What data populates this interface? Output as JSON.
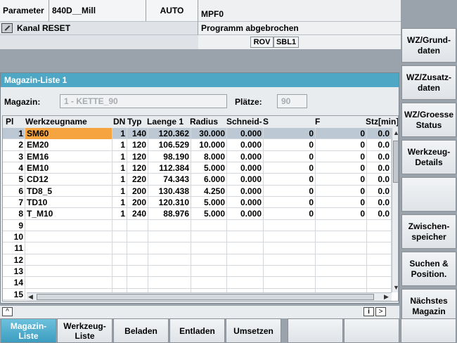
{
  "header": {
    "label": "Parameter",
    "machine": "840D__Mill",
    "mode": "AUTO",
    "program": "MPF0",
    "channel_status": "Kanal RESET",
    "program_status": "Programm abgebrochen",
    "flags": [
      "ROV",
      "SBL1"
    ]
  },
  "window": {
    "title": "Magazin-Liste 1",
    "magazin_label": "Magazin:",
    "magazin_value": "1 - KETTE_90",
    "plaetze_label": "Plätze:",
    "plaetze_value": "90"
  },
  "table": {
    "columns": [
      "Pl",
      "Werkzeugname",
      "DN",
      "Typ",
      "Laenge 1",
      "Radius",
      "Schneid-",
      "S",
      "F",
      "Stz[min]"
    ],
    "rows": [
      {
        "pl": "1",
        "name": "SM60",
        "dn": "1",
        "typ": "140",
        "laenge": "120.362",
        "radius": "30.000",
        "schneid": "0.000",
        "s": "0",
        "f": "0",
        "stz": "0.0"
      },
      {
        "pl": "2",
        "name": "EM20",
        "dn": "1",
        "typ": "120",
        "laenge": "106.529",
        "radius": "10.000",
        "schneid": "0.000",
        "s": "0",
        "f": "0",
        "stz": "0.0"
      },
      {
        "pl": "3",
        "name": "EM16",
        "dn": "1",
        "typ": "120",
        "laenge": "98.190",
        "radius": "8.000",
        "schneid": "0.000",
        "s": "0",
        "f": "0",
        "stz": "0.0"
      },
      {
        "pl": "4",
        "name": "EM10",
        "dn": "1",
        "typ": "120",
        "laenge": "112.384",
        "radius": "5.000",
        "schneid": "0.000",
        "s": "0",
        "f": "0",
        "stz": "0.0"
      },
      {
        "pl": "5",
        "name": "CD12",
        "dn": "1",
        "typ": "220",
        "laenge": "74.343",
        "radius": "6.000",
        "schneid": "0.000",
        "s": "0",
        "f": "0",
        "stz": "0.0"
      },
      {
        "pl": "6",
        "name": "TD8_5",
        "dn": "1",
        "typ": "200",
        "laenge": "130.438",
        "radius": "4.250",
        "schneid": "0.000",
        "s": "0",
        "f": "0",
        "stz": "0.0"
      },
      {
        "pl": "7",
        "name": "TD10",
        "dn": "1",
        "typ": "200",
        "laenge": "120.310",
        "radius": "5.000",
        "schneid": "0.000",
        "s": "0",
        "f": "0",
        "stz": "0.0"
      },
      {
        "pl": "8",
        "name": "T_M10",
        "dn": "1",
        "typ": "240",
        "laenge": "88.976",
        "radius": "5.000",
        "schneid": "0.000",
        "s": "0",
        "f": "0",
        "stz": "0.0"
      },
      {
        "pl": "9",
        "name": "",
        "dn": "",
        "typ": "",
        "laenge": "",
        "radius": "",
        "schneid": "",
        "s": "",
        "f": "",
        "stz": ""
      },
      {
        "pl": "10",
        "name": "",
        "dn": "",
        "typ": "",
        "laenge": "",
        "radius": "",
        "schneid": "",
        "s": "",
        "f": "",
        "stz": ""
      },
      {
        "pl": "11",
        "name": "",
        "dn": "",
        "typ": "",
        "laenge": "",
        "radius": "",
        "schneid": "",
        "s": "",
        "f": "",
        "stz": ""
      },
      {
        "pl": "12",
        "name": "",
        "dn": "",
        "typ": "",
        "laenge": "",
        "radius": "",
        "schneid": "",
        "s": "",
        "f": "",
        "stz": ""
      },
      {
        "pl": "13",
        "name": "",
        "dn": "",
        "typ": "",
        "laenge": "",
        "radius": "",
        "schneid": "",
        "s": "",
        "f": "",
        "stz": ""
      },
      {
        "pl": "14",
        "name": "",
        "dn": "",
        "typ": "",
        "laenge": "",
        "radius": "",
        "schneid": "",
        "s": "",
        "f": "",
        "stz": ""
      },
      {
        "pl": "15",
        "name": "",
        "dn": "",
        "typ": "",
        "laenge": "",
        "radius": "",
        "schneid": "",
        "s": "",
        "f": "",
        "stz": ""
      }
    ]
  },
  "right_softkeys": [
    "WZ/Grund-\ndaten",
    "WZ/Zusatz-\ndaten",
    "WZ/Groesse\nStatus",
    "Werkzeug-\nDetails",
    "",
    "Zwischen-\nspeicher",
    "Suchen &\nPosition.",
    "Nächstes\nMagazin"
  ],
  "bottom_softkeys": [
    "Magazin-\nListe",
    "Werkzeug-\nListe",
    "Beladen",
    "Entladen",
    "Umsetzen",
    "",
    "",
    ""
  ],
  "icons": {
    "channel": "channel-reset-icon",
    "up": "recall-up-icon",
    "info": "info-icon",
    "next": "next-arrow-icon"
  }
}
